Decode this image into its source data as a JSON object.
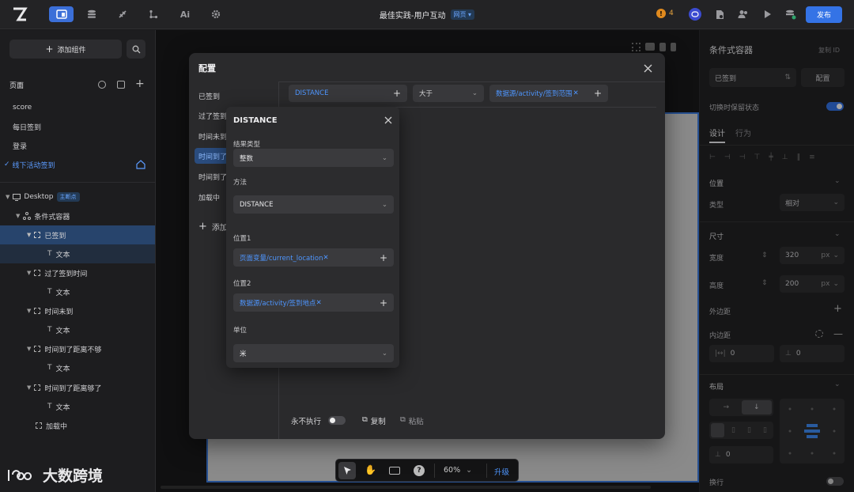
{
  "topbar": {
    "title": "最佳实践-用户互动",
    "page_tag": "网页 ▾",
    "warning_count": "4",
    "publish": "发布",
    "ai_label": "Ai"
  },
  "left": {
    "add_component": "添加组件",
    "pages_title": "页面",
    "pages": [
      "score",
      "每日签到",
      "登录",
      "线下活动签到"
    ],
    "tree": {
      "desktop": "Desktop",
      "main_tag": "主断点",
      "container": "条件式容器",
      "items": [
        {
          "label": "已签到",
          "child": "文本"
        },
        {
          "label": "过了签到时间",
          "child": "文本"
        },
        {
          "label": "时间未到",
          "child": "文本"
        },
        {
          "label": "时间到了距离不够",
          "child": "文本"
        },
        {
          "label": "时间到了距离够了",
          "child": "文本"
        }
      ],
      "loading": "加载中"
    },
    "watermark": "大数跨境"
  },
  "right": {
    "title": "条件式容器",
    "copy_id": "复制 ID",
    "state_value": "已签到",
    "config_button": "配置",
    "keep_state": "切换时保留状态",
    "tab_design": "设计",
    "tab_behavior": "行为",
    "position_section": "位置",
    "type_label": "类型",
    "type_value": "相对",
    "size_section": "尺寸",
    "width_label": "宽度",
    "width_value": "320",
    "height_label": "高度",
    "height_value": "200",
    "unit_px": "px",
    "margin_label": "外边距",
    "padding_label": "内边距",
    "padding_h": "0",
    "padding_v": "0",
    "layout_section": "布局",
    "gap_value": "0",
    "wrap_label": "换行"
  },
  "modal": {
    "title": "配置",
    "sidebar": [
      "已签到",
      "过了签到",
      "时间未到",
      "时间到了",
      "时间到了",
      "加载中"
    ],
    "add_label": "添加",
    "condition": {
      "left": "DISTANCE",
      "operator": "大于",
      "right": "数据源/activity/签到范围"
    },
    "never_execute": "永不执行",
    "copy": "复制",
    "paste": "粘贴"
  },
  "popover": {
    "title": "DISTANCE",
    "result_type_label": "结果类型",
    "result_type_value": "整数",
    "method_label": "方法",
    "method_value": "DISTANCE",
    "pos1_label": "位置1",
    "pos1_value": "页面变量/current_location",
    "pos2_label": "位置2",
    "pos2_value": "数据源/activity/签到地点",
    "unit_label": "单位",
    "unit_value": "米"
  },
  "dock": {
    "zoom": "60%",
    "upgrade": "升级"
  },
  "colors": {
    "accent": "#3473e6",
    "link_blue": "#4e96ff",
    "selected_row": "#27446c"
  }
}
